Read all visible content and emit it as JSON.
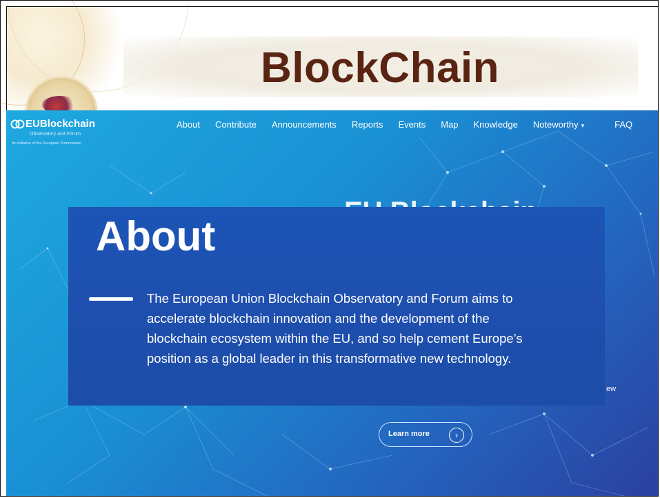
{
  "slide": {
    "title": "BlockChain"
  },
  "site": {
    "logo": {
      "name": "EUBlockchain",
      "subtitle": "Observatory and Forum",
      "tagline": "An initiative of the European Commission"
    },
    "nav": {
      "items": [
        "About",
        "Contribute",
        "Announcements",
        "Reports",
        "Events",
        "Map",
        "Knowledge",
        "Noteworthy",
        "FAQ"
      ],
      "dropdown_caret": "▾"
    },
    "background_heading": "EU Blockchain",
    "background_fragment": "ew",
    "learn_more": {
      "label": "Learn more",
      "icon": "chevron-right-icon"
    }
  },
  "about_overlay": {
    "heading": "About",
    "lines": [
      "The European Union Blockchain Observatory and Forum aims to",
      "accelerate blockchain innovation and the development of the",
      "blockchain ecosystem within the EU, and so help cement Europe’s",
      "position as a global leader in this transformative new technology."
    ]
  },
  "colors": {
    "title": "#5a2412",
    "site_gradient_start": "#1ea9e0",
    "site_gradient_end": "#2b3f9f",
    "overlay": "#1e56b3"
  }
}
